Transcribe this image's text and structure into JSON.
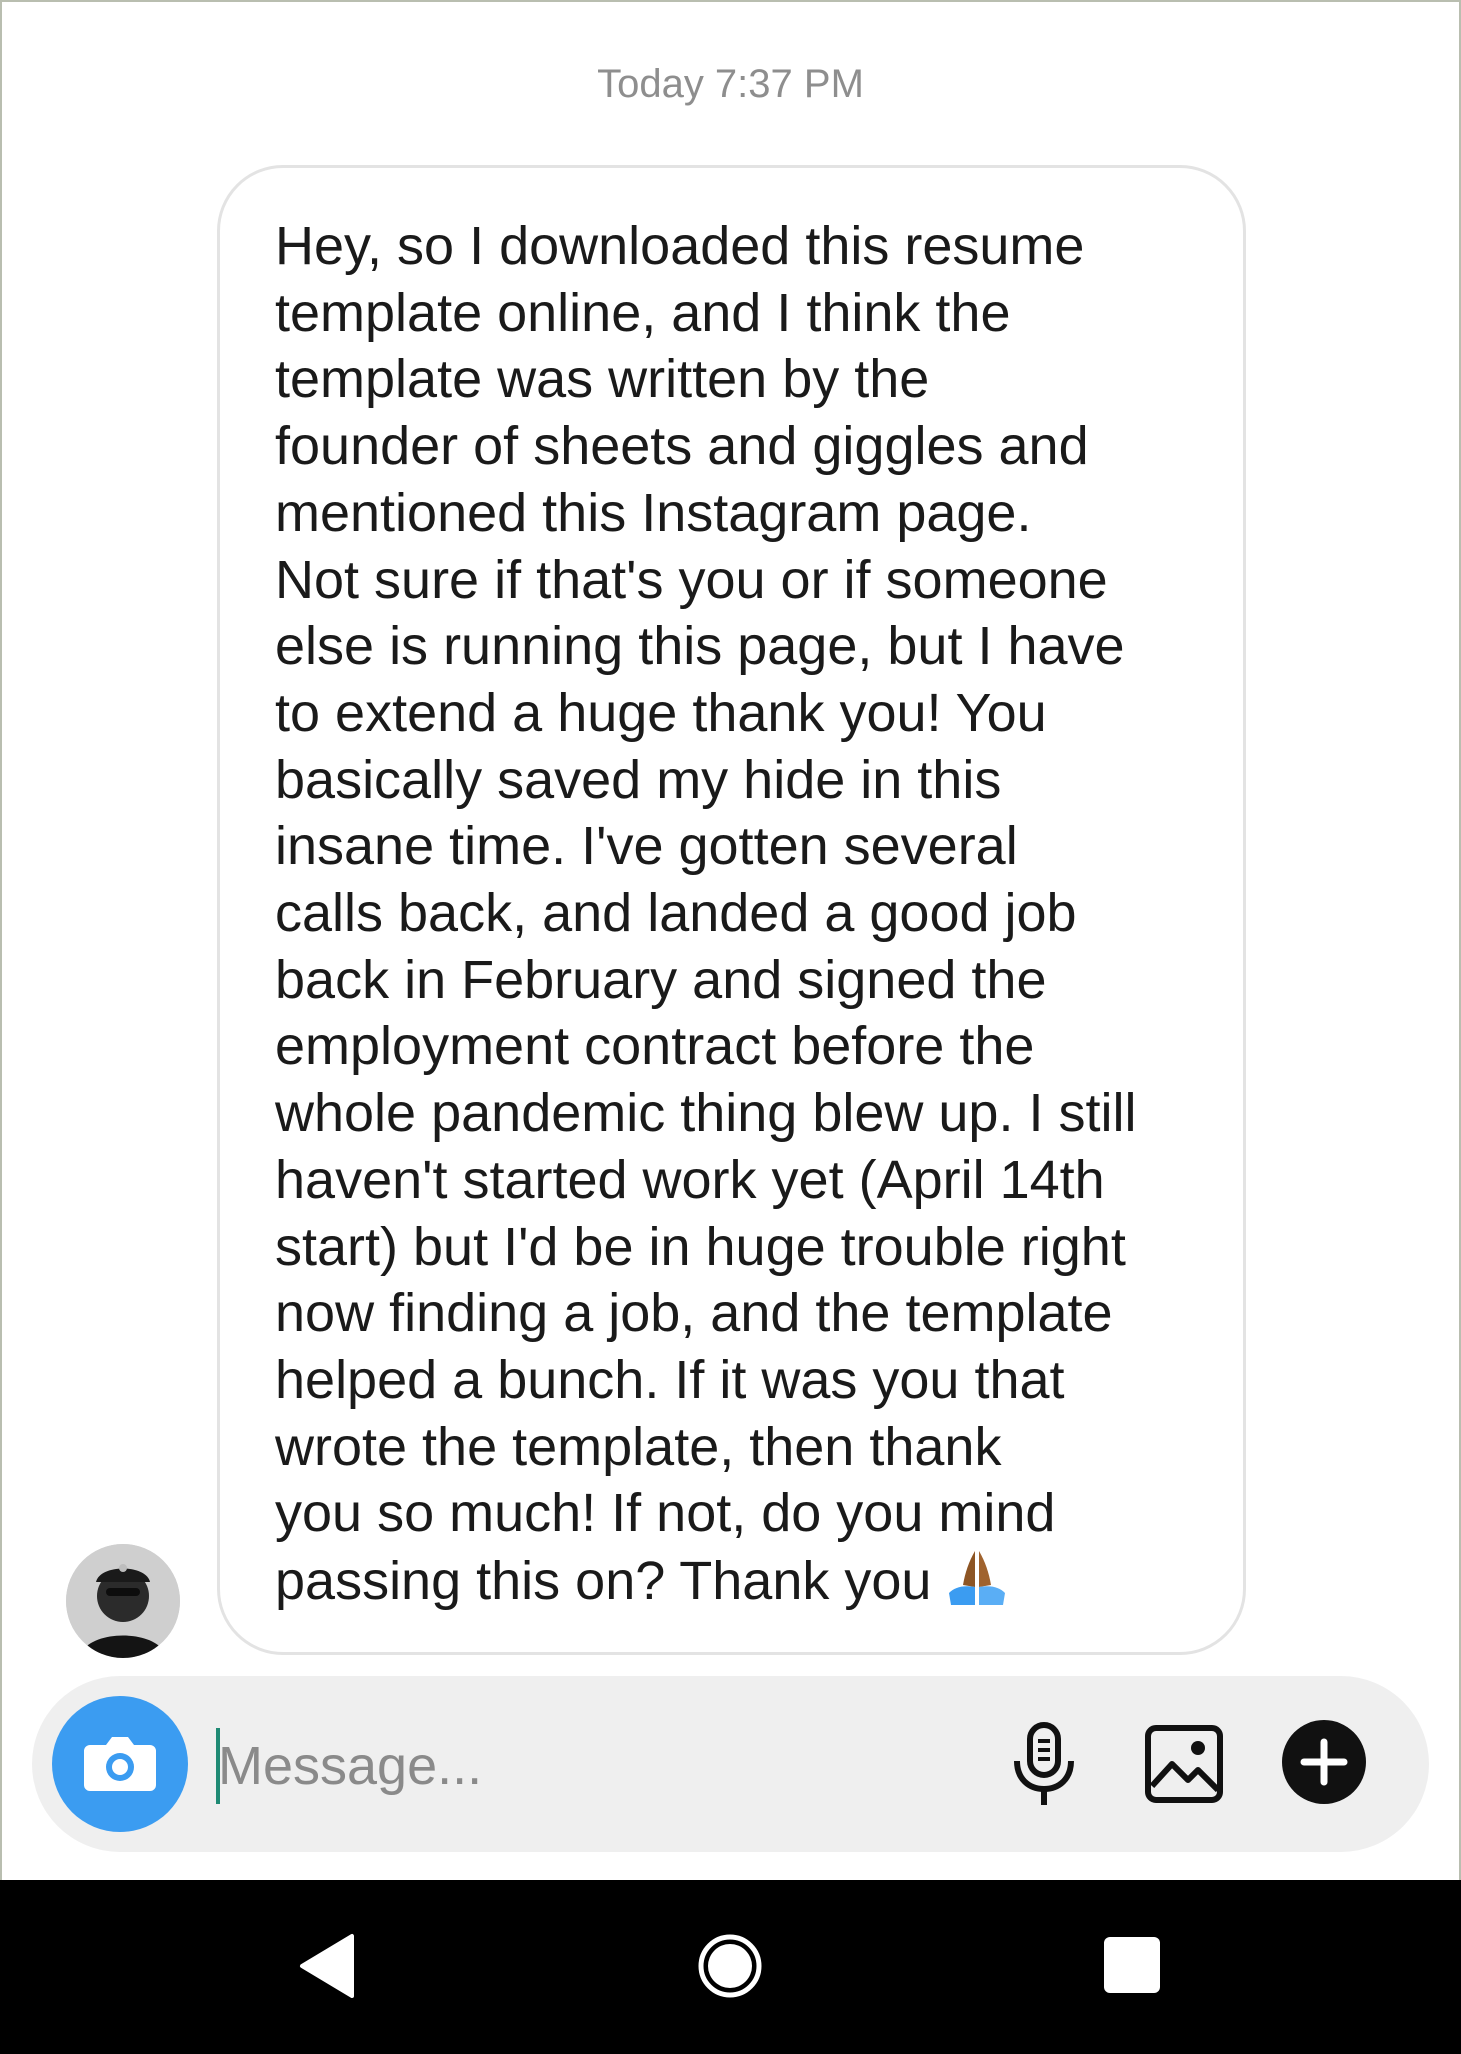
{
  "thread": {
    "timestamp": "Today 7:37 PM"
  },
  "message": {
    "text": "Hey, so I downloaded this resume\ntemplate online, and I think the\ntemplate was written by the\nfounder of sheets and giggles and\nmentioned this Instagram page.\nNot sure if that's you or if someone\nelse is running this page, but I have\nto extend a huge thank you! You\nbasically saved my hide in this\ninsane time. I've gotten several\ncalls back, and landed a good job\nback in February and signed the\nemployment contract before the\nwhole pandemic thing blew up. I still\nhaven't started work yet (April 14th\nstart) but I'd be in huge trouble right\nnow finding a job, and the template\nhelped a bunch. If it was you that\nwrote the template, then thank\nyou so much! If not, do you mind\npassing this on? Thank you",
    "emoji": "folded-hands-icon",
    "sender_avatar": "avatar"
  },
  "composer": {
    "placeholder": "Message...",
    "value": "",
    "camera_icon": "camera-icon",
    "mic_icon": "microphone-icon",
    "gallery_icon": "image-icon",
    "plus_icon": "plus-icon",
    "camera_color": "#3b9cf1"
  },
  "navbar": {
    "back_icon": "back-triangle-icon",
    "home_icon": "home-circle-icon",
    "recents_icon": "recents-square-icon"
  },
  "colors": {
    "bubble_border": "#e3e3e3",
    "composer_bg": "#efefef",
    "timestamp": "#8e8e8e",
    "navbar_bg": "#000000"
  }
}
